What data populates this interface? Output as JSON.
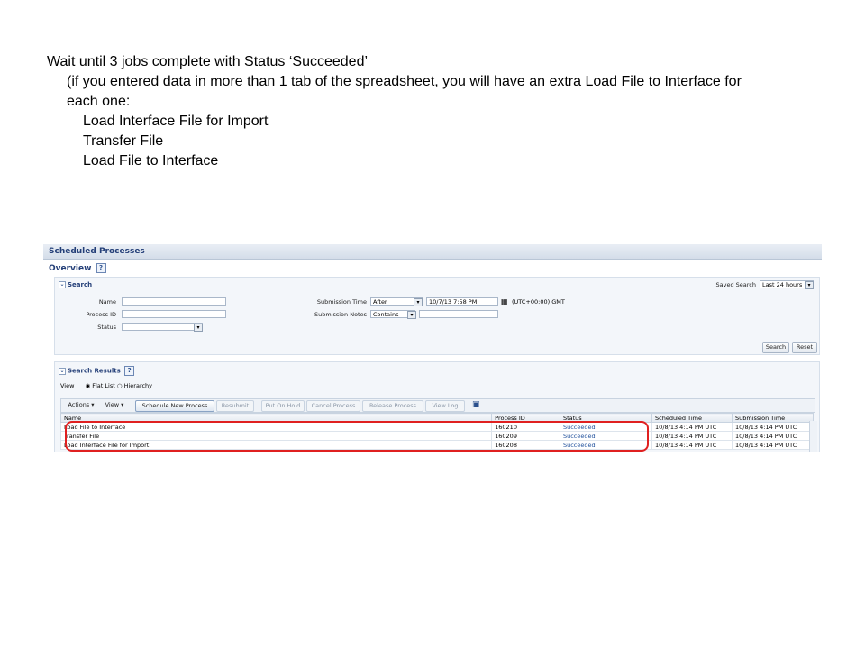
{
  "instructions": {
    "line1": "Wait until 3 jobs complete with Status ‘Succeeded’",
    "line2": "(if you entered data in more than 1 tab of the spreadsheet, you will have an extra Load File to Interface for",
    "line3": "each one:",
    "items": [
      "Load Interface File for Import",
      "Transfer File",
      "Load File to Interface"
    ]
  },
  "app": {
    "title": "Scheduled Processes",
    "overview": "Overview",
    "help_glyph": "?"
  },
  "search": {
    "header": "Search",
    "saved_search_label": "Saved Search",
    "saved_search_value": "Last 24 hours",
    "name_label": "Name",
    "process_id_label": "Process ID",
    "status_label": "Status",
    "submission_time_label": "Submission Time",
    "submission_time_op": "After",
    "submission_time_value": "10/7/13 7:58 PM",
    "timezone": "(UTC+00:00) GMT",
    "submission_notes_label": "Submission Notes",
    "submission_notes_op": "Contains",
    "search_button": "Search",
    "reset_button": "Reset"
  },
  "results": {
    "header": "Search Results",
    "view_label": "View",
    "flat_list": "Flat List",
    "hierarchy": "Hierarchy",
    "toolbar": {
      "actions": "Actions ▾",
      "view": "View ▾",
      "schedule": "Schedule New Process",
      "resubmit": "Resubmit",
      "hold": "Put On Hold",
      "cancel": "Cancel Process",
      "release": "Release Process",
      "log": "View Log"
    },
    "columns": [
      "Name",
      "Process ID",
      "Status",
      "Scheduled Time",
      "Submission Time"
    ],
    "rows": [
      [
        "Load File to Interface",
        "160210",
        "Succeeded",
        "10/8/13 4:14 PM UTC",
        "10/8/13 4:14 PM UTC"
      ],
      [
        "Transfer File",
        "160209",
        "Succeeded",
        "10/8/13 4:14 PM UTC",
        "10/8/13 4:14 PM UTC"
      ],
      [
        "Load Interface File for Import",
        "160208",
        "Succeeded",
        "10/8/13 4:14 PM UTC",
        "10/8/13 4:14 PM UTC"
      ]
    ]
  },
  "colors": {
    "highlight": "#e02020",
    "title_text": "#243f78",
    "status_link": "#1f4f9b"
  }
}
